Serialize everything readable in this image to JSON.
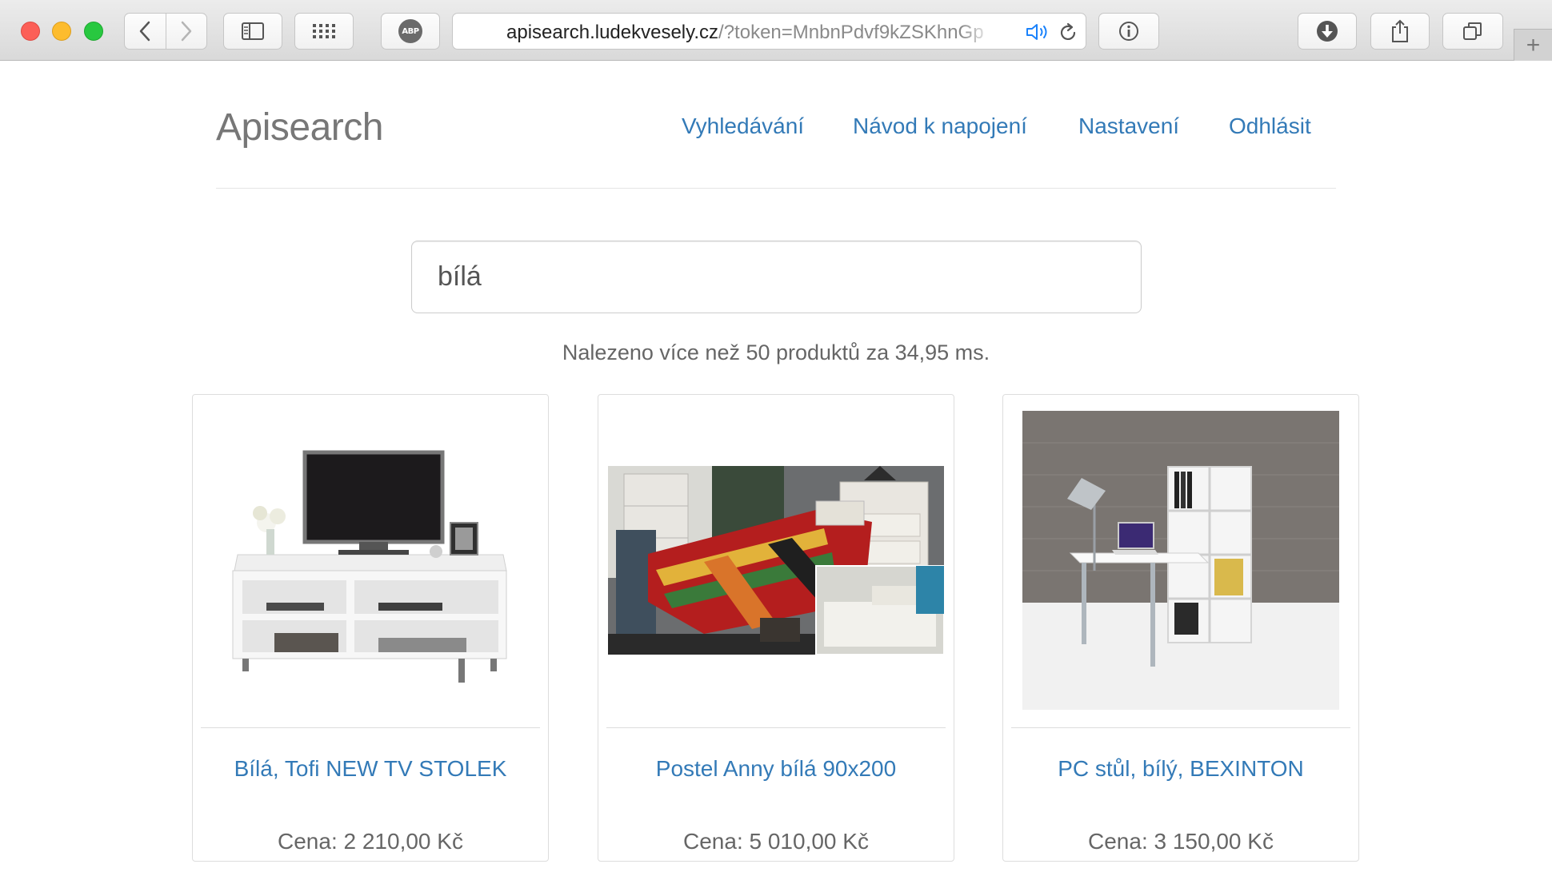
{
  "browser": {
    "adblock_label": "ABP",
    "url_host": "apisearch.ludekvesely.cz",
    "url_rest": "/?token=MnbnPdvf9kZSKhnGp",
    "new_tab_symbol": "+"
  },
  "header": {
    "brand": "Apisearch",
    "nav": [
      {
        "label": "Vyhledávání"
      },
      {
        "label": "Návod k napojení"
      },
      {
        "label": "Nastavení"
      },
      {
        "label": "Odhlásit"
      }
    ]
  },
  "search": {
    "query": "bílá",
    "result_summary": "Nalezeno více než 50 produktů za 34,95 ms."
  },
  "products": [
    {
      "title": "Bílá, Tofi NEW TV STOLEK",
      "price": "Cena: 2 210,00 Kč",
      "image": "white-tv-stand-photo"
    },
    {
      "title": "Postel Anny bílá 90x200",
      "price": "Cena: 5 010,00 Kč",
      "image": "white-bed-photo"
    },
    {
      "title": "PC stůl, bílý, BEXINTON",
      "price": "Cena: 3 150,00 Kč",
      "image": "white-pc-desk-photo"
    }
  ],
  "icons": [
    "back-icon",
    "forward-icon",
    "sidebar-icon",
    "top-sites-grid-icon",
    "adblock-icon",
    "audio-icon",
    "reload-icon",
    "info-icon",
    "download-icon",
    "share-icon",
    "tabs-icon"
  ],
  "colors": {
    "link": "#337ab7",
    "brand_text": "#777777",
    "close": "#fc5f57",
    "minimize": "#fdbc2e",
    "zoom": "#28c840"
  }
}
